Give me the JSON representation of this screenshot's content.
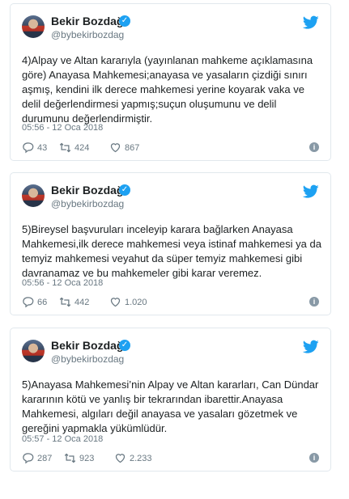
{
  "tweets": [
    {
      "author": "Bekir Bozdağ",
      "handle": "@bybekirbozdag",
      "text": "4)Alpay ve Altan kararıyla (yayınlanan mahkeme açıklamasına göre) Anayasa Mahkemesi;anayasa ve yasaların çizdiği sınırı aşmış, kendini ilk derece mahkemesi yerine koyarak vaka ve delil değerlendirmesi yapmış;suçun oluşumunu ve delil durumunu değerlendirmiştir.",
      "time": "05:56 - 12 Oca 2018",
      "replies": "43",
      "retweets": "424",
      "likes": "867"
    },
    {
      "author": "Bekir Bozdağ",
      "handle": "@bybekirbozdag",
      "text": "5)Bireysel başvuruları inceleyip karara bağlarken Anayasa Mahkemesi,ilk derece mahkemesi veya istinaf mahkemesi ya da temyiz mahkemesi veyahut da süper temyiz mahkemesi gibi davranamaz ve bu mahkemeler gibi karar veremez.",
      "time": "05:56 - 12 Oca 2018",
      "replies": "66",
      "retweets": "442",
      "likes": "1.020"
    },
    {
      "author": "Bekir Bozdağ",
      "handle": "@bybekirbozdag",
      "text": "5)Anayasa Mahkemesi’nin Alpay ve Altan kararları, Can Dündar kararının kötü ve yanlış bir tekrarından ibarettir.Anayasa Mahkemesi, algıları değil anayasa ve yasaları gözetmek ve gereğini yapmakla yükümlüdür.",
      "time": "05:57 - 12 Oca 2018",
      "replies": "287",
      "retweets": "923",
      "likes": "2.233"
    }
  ],
  "icons": {
    "verified": "verified-badge-icon",
    "bird": "twitter-bird-icon",
    "reply": "reply-icon",
    "retweet": "retweet-icon",
    "like": "heart-icon",
    "info": "info-icon"
  },
  "colors": {
    "brand": "#1da1f2",
    "muted": "#697882",
    "border": "#e1e8ed"
  }
}
